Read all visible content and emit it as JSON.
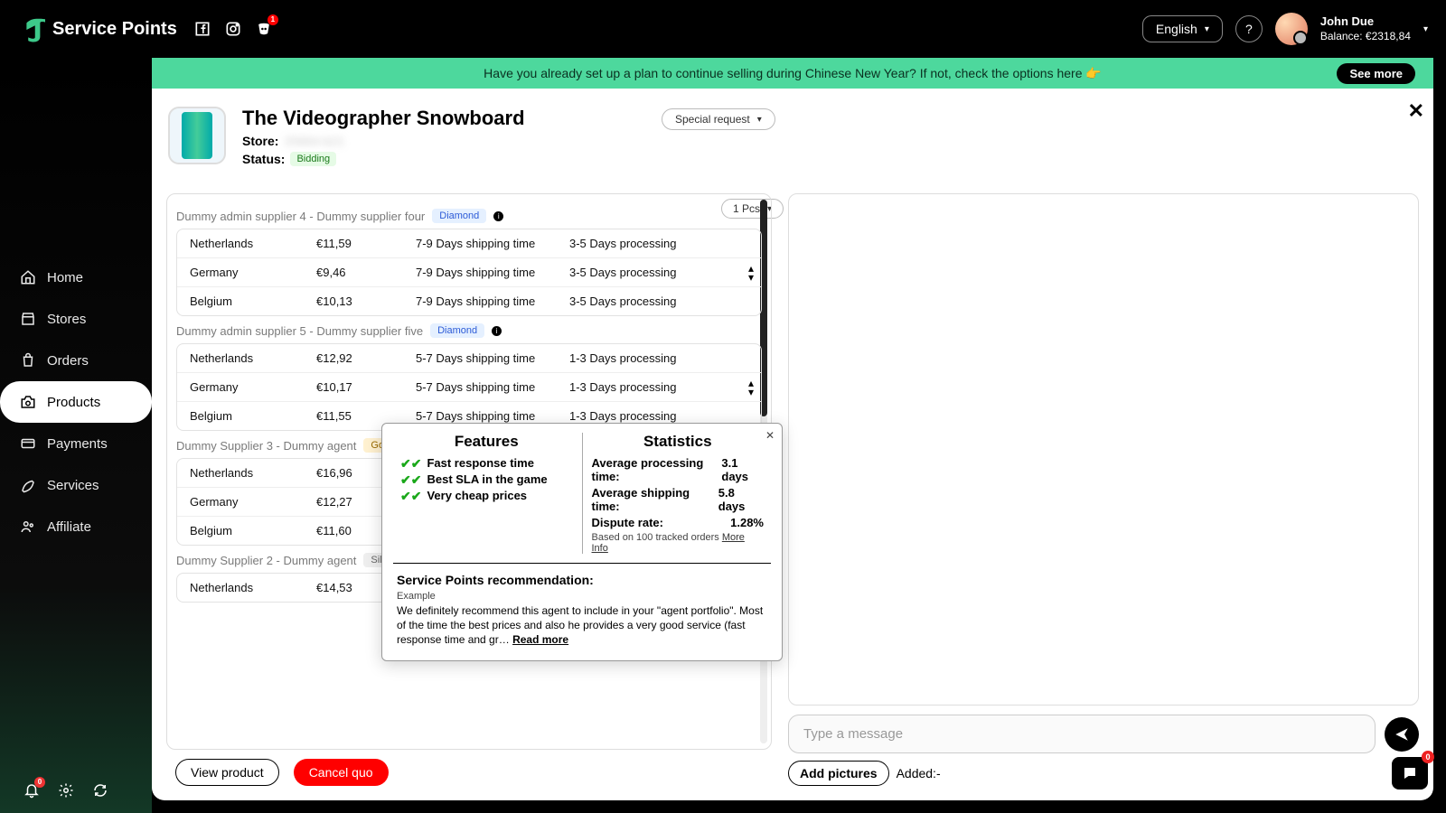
{
  "brand": "Service Points",
  "language": "English",
  "user": {
    "name": "John Due",
    "balance_label": "Balance:",
    "balance": "€2318,84"
  },
  "banner": {
    "text": "Have you already set up a plan to continue selling during Chinese New Year? If not, check the options here 👉",
    "cta": "See more"
  },
  "closed_discord_badge": "1",
  "product": {
    "title": "The Videographer Snowboard",
    "store_label": "Store:",
    "store_value": "25664-b21",
    "status_label": "Status:",
    "status_value": "Bidding",
    "special_request": "Special request",
    "qty": "1 Pcs"
  },
  "sidebar": {
    "items": [
      "Home",
      "Stores",
      "Orders",
      "Products",
      "Payments",
      "Services",
      "Affiliate"
    ],
    "active_index": 3,
    "bell_badge": "0",
    "fab_badge": "0"
  },
  "suppliers": [
    {
      "name": "Dummy admin supplier 4 - Dummy supplier four",
      "tier": "Diamond",
      "rows": [
        {
          "country": "Netherlands",
          "price": "€11,59",
          "ship": "7-9 Days shipping time",
          "proc": "3-5 Days processing"
        },
        {
          "country": "Germany",
          "price": "€9,46",
          "ship": "7-9 Days shipping time",
          "proc": "3-5 Days processing"
        },
        {
          "country": "Belgium",
          "price": "€10,13",
          "ship": "7-9 Days shipping time",
          "proc": "3-5 Days processing"
        }
      ]
    },
    {
      "name": "Dummy admin supplier 5 - Dummy supplier five",
      "tier": "Diamond",
      "rows": [
        {
          "country": "Netherlands",
          "price": "€12,92",
          "ship": "5-7 Days shipping time",
          "proc": "1-3 Days processing"
        },
        {
          "country": "Germany",
          "price": "€10,17",
          "ship": "5-7 Days shipping time",
          "proc": "1-3 Days processing"
        },
        {
          "country": "Belgium",
          "price": "€11,55",
          "ship": "5-7 Days shipping time",
          "proc": "1-3 Days processing"
        }
      ]
    },
    {
      "name": "Dummy Supplier 3 - Dummy agent",
      "tier": "Gold",
      "rows": [
        {
          "country": "Netherlands",
          "price": "€16,96",
          "ship": "",
          "proc": ""
        },
        {
          "country": "Germany",
          "price": "€12,27",
          "ship": "",
          "proc": ""
        },
        {
          "country": "Belgium",
          "price": "€11,60",
          "ship": "",
          "proc": ""
        }
      ]
    },
    {
      "name": "Dummy Supplier 2 - Dummy agent",
      "tier": "Silver",
      "rows": [
        {
          "country": "Netherlands",
          "price": "€14,53",
          "ship": "",
          "proc": ""
        }
      ]
    }
  ],
  "actions": {
    "view": "View product",
    "cancel": "Cancel quo"
  },
  "chat": {
    "placeholder": "Type a message",
    "add_pictures": "Add pictures",
    "added_label": "Added:-"
  },
  "popover": {
    "features_h": "Features",
    "stats_h": "Statistics",
    "features": [
      "Fast response time",
      "Best SLA in the game",
      "Very cheap prices"
    ],
    "stat_proc_label": "Average processing time:",
    "stat_proc_val": "3.1 days",
    "stat_ship_label": "Average shipping time:",
    "stat_ship_val": "5.8 days",
    "stat_dispute_label": "Dispute rate:",
    "stat_dispute_val": "1.28%",
    "based_on": "Based on 100 tracked orders ",
    "more_info": "More Info",
    "reco_h": "Service Points recommendation:",
    "example": "Example",
    "body": "We definitely recommend this agent to include in your \"agent portfolio\". Most of the time the best prices and also he provides a very good service (fast response time and gr… ",
    "read_more": "Read more"
  }
}
